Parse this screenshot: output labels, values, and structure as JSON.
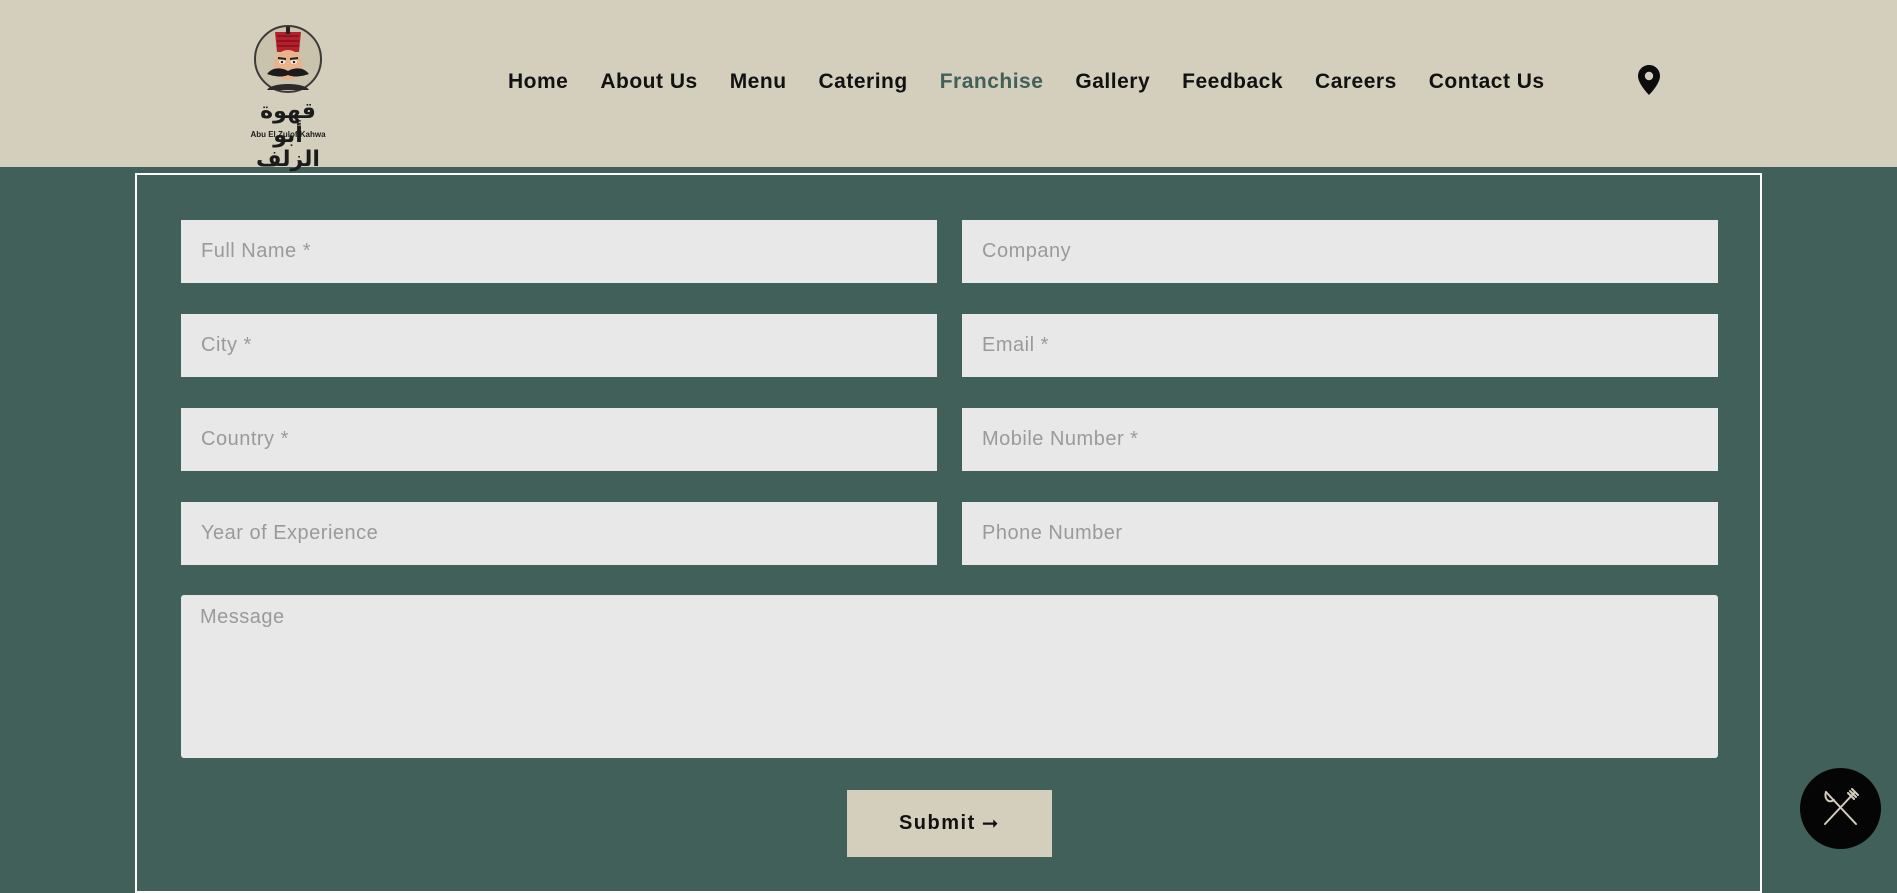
{
  "logo": {
    "arabic_text": "قهوة أبو الزلف",
    "english_text": "Abu El Zulof Kahwa"
  },
  "nav": {
    "items": [
      {
        "label": "Home"
      },
      {
        "label": "About Us"
      },
      {
        "label": "Menu"
      },
      {
        "label": "Catering"
      },
      {
        "label": "Franchise",
        "active": true
      },
      {
        "label": "Gallery"
      },
      {
        "label": "Feedback"
      },
      {
        "label": "Careers"
      },
      {
        "label": "Contact Us"
      }
    ],
    "location_icon": "map-pin-icon"
  },
  "form": {
    "full_name": {
      "placeholder": "Full Name *",
      "value": ""
    },
    "company": {
      "placeholder": "Company",
      "value": ""
    },
    "city": {
      "placeholder": "City *",
      "value": ""
    },
    "email": {
      "placeholder": "Email *",
      "value": ""
    },
    "country": {
      "placeholder": "Country *",
      "value": ""
    },
    "mobile_number": {
      "placeholder": "Mobile Number *",
      "value": ""
    },
    "year_of_experience": {
      "placeholder": "Year of Experience",
      "value": ""
    },
    "phone_number": {
      "placeholder": "Phone Number",
      "value": ""
    },
    "message": {
      "placeholder": "Message",
      "value": ""
    },
    "submit_label": "Submit",
    "submit_arrow": "➞"
  },
  "fab": {
    "icon": "fork-knife-icon"
  },
  "colors": {
    "header_bg": "#d4cebd",
    "page_bg": "#41605a",
    "field_bg": "#e8e8e8",
    "active_nav": "#41605a",
    "fab_bg": "#050505"
  }
}
